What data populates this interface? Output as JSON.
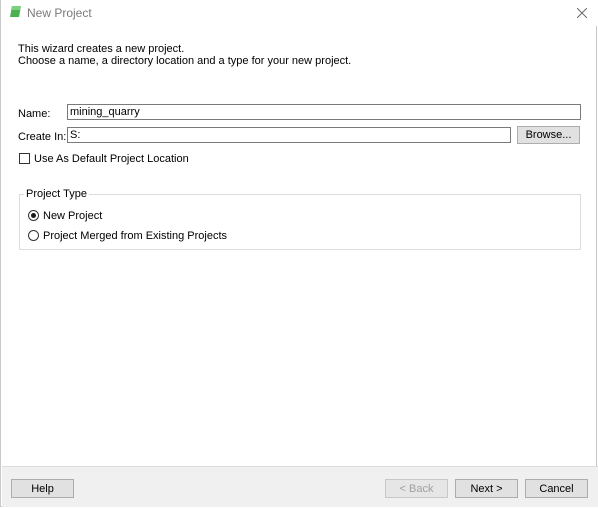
{
  "window": {
    "title": "New Project",
    "accent_color": "#4caf50"
  },
  "description": {
    "line1": "This wizard creates a new project.",
    "line2": "Choose a name, a directory location and a type for your new project."
  },
  "form": {
    "name_label": "Name:",
    "name_value": "mining_quarry",
    "create_in_label": "Create In:",
    "create_in_value": "S:",
    "browse_label": "Browse...",
    "default_location_label": "Use As Default Project Location",
    "default_location_checked": false
  },
  "project_type": {
    "title": "Project Type",
    "options": [
      {
        "label": "New Project",
        "selected": true
      },
      {
        "label": "Project Merged from Existing Projects",
        "selected": false
      }
    ]
  },
  "footer": {
    "help_label": "Help",
    "back_label": "< Back",
    "next_label": "Next >",
    "cancel_label": "Cancel"
  },
  "icons": {
    "app": "app-icon",
    "close": "close-icon"
  }
}
